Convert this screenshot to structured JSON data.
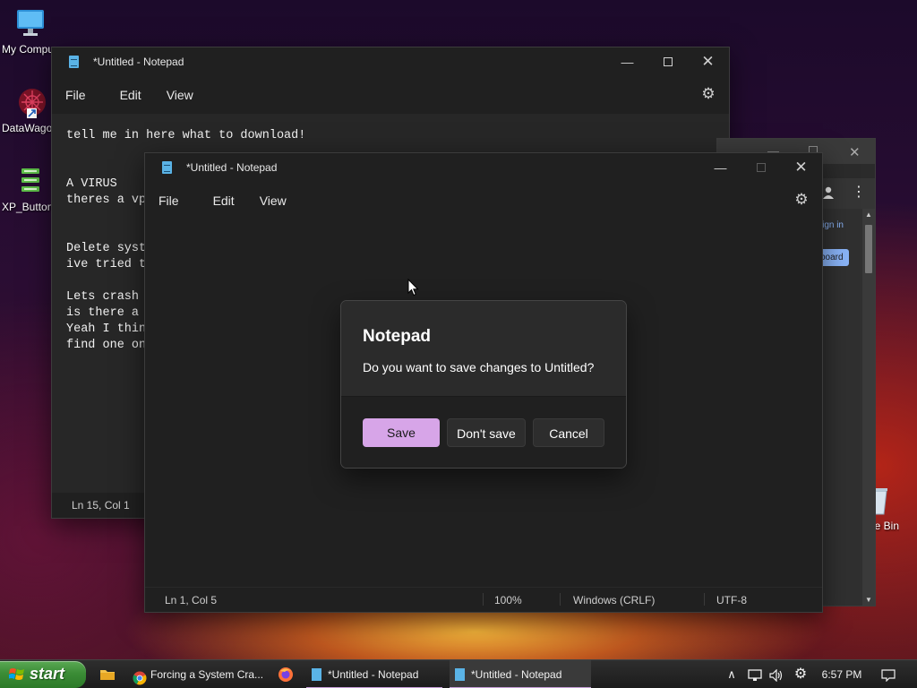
{
  "desktop": {
    "icons": [
      {
        "label": "My Computer"
      },
      {
        "label": "DataWagon"
      },
      {
        "label": "XP_Buttons"
      },
      {
        "label": "Recycle Bin"
      }
    ]
  },
  "back_notepad": {
    "title": "*Untitled - Notepad",
    "menu": [
      "File",
      "Edit",
      "View"
    ],
    "content": "tell me in here what to download!\n\n\nA VIRUS\ntheres a vp\n\n\nDelete syst\nive tried t\n\nLets crash \nis there a \nYeah I thin\nfind one on",
    "status_position": "Ln 15, Col 1"
  },
  "browser_window": {
    "sign_in": "Sign in",
    "board_button": "board"
  },
  "front_notepad": {
    "title": "*Untitled - Notepad",
    "menu": [
      "File",
      "Edit",
      "View"
    ],
    "content": "",
    "status": {
      "position": "Ln 1, Col 5",
      "zoom": "100%",
      "line_ending": "Windows (CRLF)",
      "encoding": "UTF-8"
    }
  },
  "dialog": {
    "title": "Notepad",
    "message": "Do you want to save changes to Untitled?",
    "buttons": {
      "save": "Save",
      "dont_save": "Don't save",
      "cancel": "Cancel"
    }
  },
  "taskbar": {
    "start_label": "start",
    "items": [
      {
        "label": "Forcing a System Cra...",
        "icon": "chrome-icon"
      },
      {
        "label": "*Untitled - Notepad",
        "icon": "notepad-icon"
      },
      {
        "label": "*Untitled - Notepad",
        "icon": "notepad-icon"
      }
    ],
    "clock": "6:57 PM"
  },
  "colors": {
    "accent": "#d7a5e8",
    "start_green": "#3b8c36",
    "window_bg": "#202020",
    "editor_bg": "#272727"
  }
}
